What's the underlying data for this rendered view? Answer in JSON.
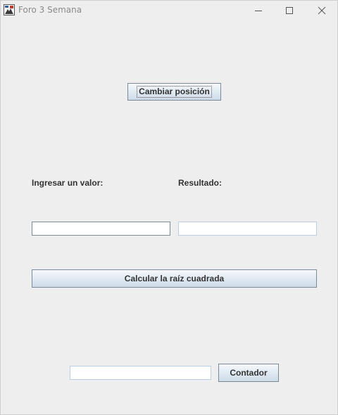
{
  "window": {
    "title": "Foro 3 Semana",
    "icon": "java-app-icon",
    "controls": [
      "minimize-icon",
      "maximize-icon",
      "close-icon"
    ]
  },
  "main": {
    "change_position_button": "Cambiar posición",
    "input_label": "Ingresar un valor:",
    "input_value": "",
    "result_label": "Resultado:",
    "result_value": "",
    "calculate_button": "Calcular la raíz cuadrada",
    "counter_value": "",
    "counter_button": "Contador"
  },
  "colors": {
    "background": "#eeeeee",
    "button_border": "#7a8a99",
    "button_top": "#f6f9fc",
    "button_bottom": "#cddbe8",
    "text": "#333333",
    "title_text": "#8a8a8a",
    "field_border_focus": "#7a8a99",
    "field_border": "#b8cfe5"
  }
}
